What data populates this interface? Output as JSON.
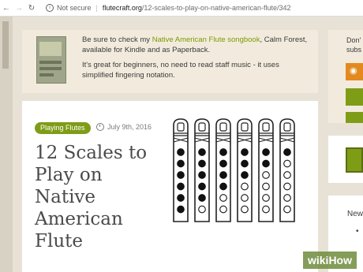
{
  "browser": {
    "security_label": "Not secure",
    "url_domain": "flutecraft.org",
    "url_path": "/12-scales-to-play-on-native-american-flute/342"
  },
  "promo": {
    "text_before_link": "Be sure to check my ",
    "link_text": "Native American Flute songbook",
    "text_after_link": ", Calm Forest, available for Kindle and as Paperback.",
    "second_paragraph": "It's great for beginners, no need to read staff music - it uses simplified fingering notation."
  },
  "article": {
    "category": "Playing Flutes",
    "date": "July 9th, 2016",
    "title": "12 Scales to Play on Native American Flute"
  },
  "fingering_charts": [
    [
      1,
      1,
      1,
      1,
      1,
      1
    ],
    [
      1,
      1,
      1,
      1,
      1,
      0
    ],
    [
      1,
      1,
      1,
      1,
      0,
      0
    ],
    [
      1,
      1,
      1,
      0,
      0,
      0
    ],
    [
      1,
      1,
      0,
      0,
      0,
      0
    ],
    [
      1,
      0,
      0,
      0,
      0,
      0
    ]
  ],
  "sidebar": {
    "text_line1": "Don'",
    "text_line2": "subs",
    "section_label": "New",
    "bullet": "•"
  },
  "watermark": "wikiHow",
  "colors": {
    "accent_green": "#7f9c17",
    "rss_orange": "#e38a1f"
  }
}
